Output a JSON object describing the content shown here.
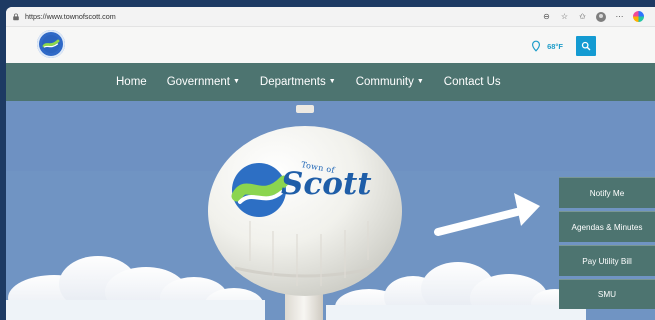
{
  "browser": {
    "url": "https://www.townofscott.com"
  },
  "header": {
    "temperature": "68°F"
  },
  "navigation": {
    "items": [
      {
        "label": "Home",
        "has_dropdown": false
      },
      {
        "label": "Government",
        "has_dropdown": true
      },
      {
        "label": "Departments",
        "has_dropdown": true
      },
      {
        "label": "Community",
        "has_dropdown": true
      },
      {
        "label": "Contact Us",
        "has_dropdown": false
      }
    ]
  },
  "hero": {
    "tower_text_top": "Town of",
    "tower_text_main": "Scott"
  },
  "side_menu": {
    "items": [
      "Notify Me",
      "Agendas & Minutes",
      "Pay Utility Bill",
      "SMU"
    ]
  },
  "colors": {
    "nav_bg": "#4d7470",
    "search_bg": "#149bd2",
    "temperature_text": "#1e9dc9",
    "hero_sky": "#6f93c2"
  },
  "icons": {
    "lock": "lock-icon",
    "zoom": "zoom-icon",
    "favorite": "star-icon",
    "collections": "collections-icon",
    "profile": "profile-icon",
    "more": "more-icon",
    "browser": "edge-icon",
    "weather": "weather-icon",
    "search": "search-icon",
    "dropdown": "chevron-down-icon"
  }
}
